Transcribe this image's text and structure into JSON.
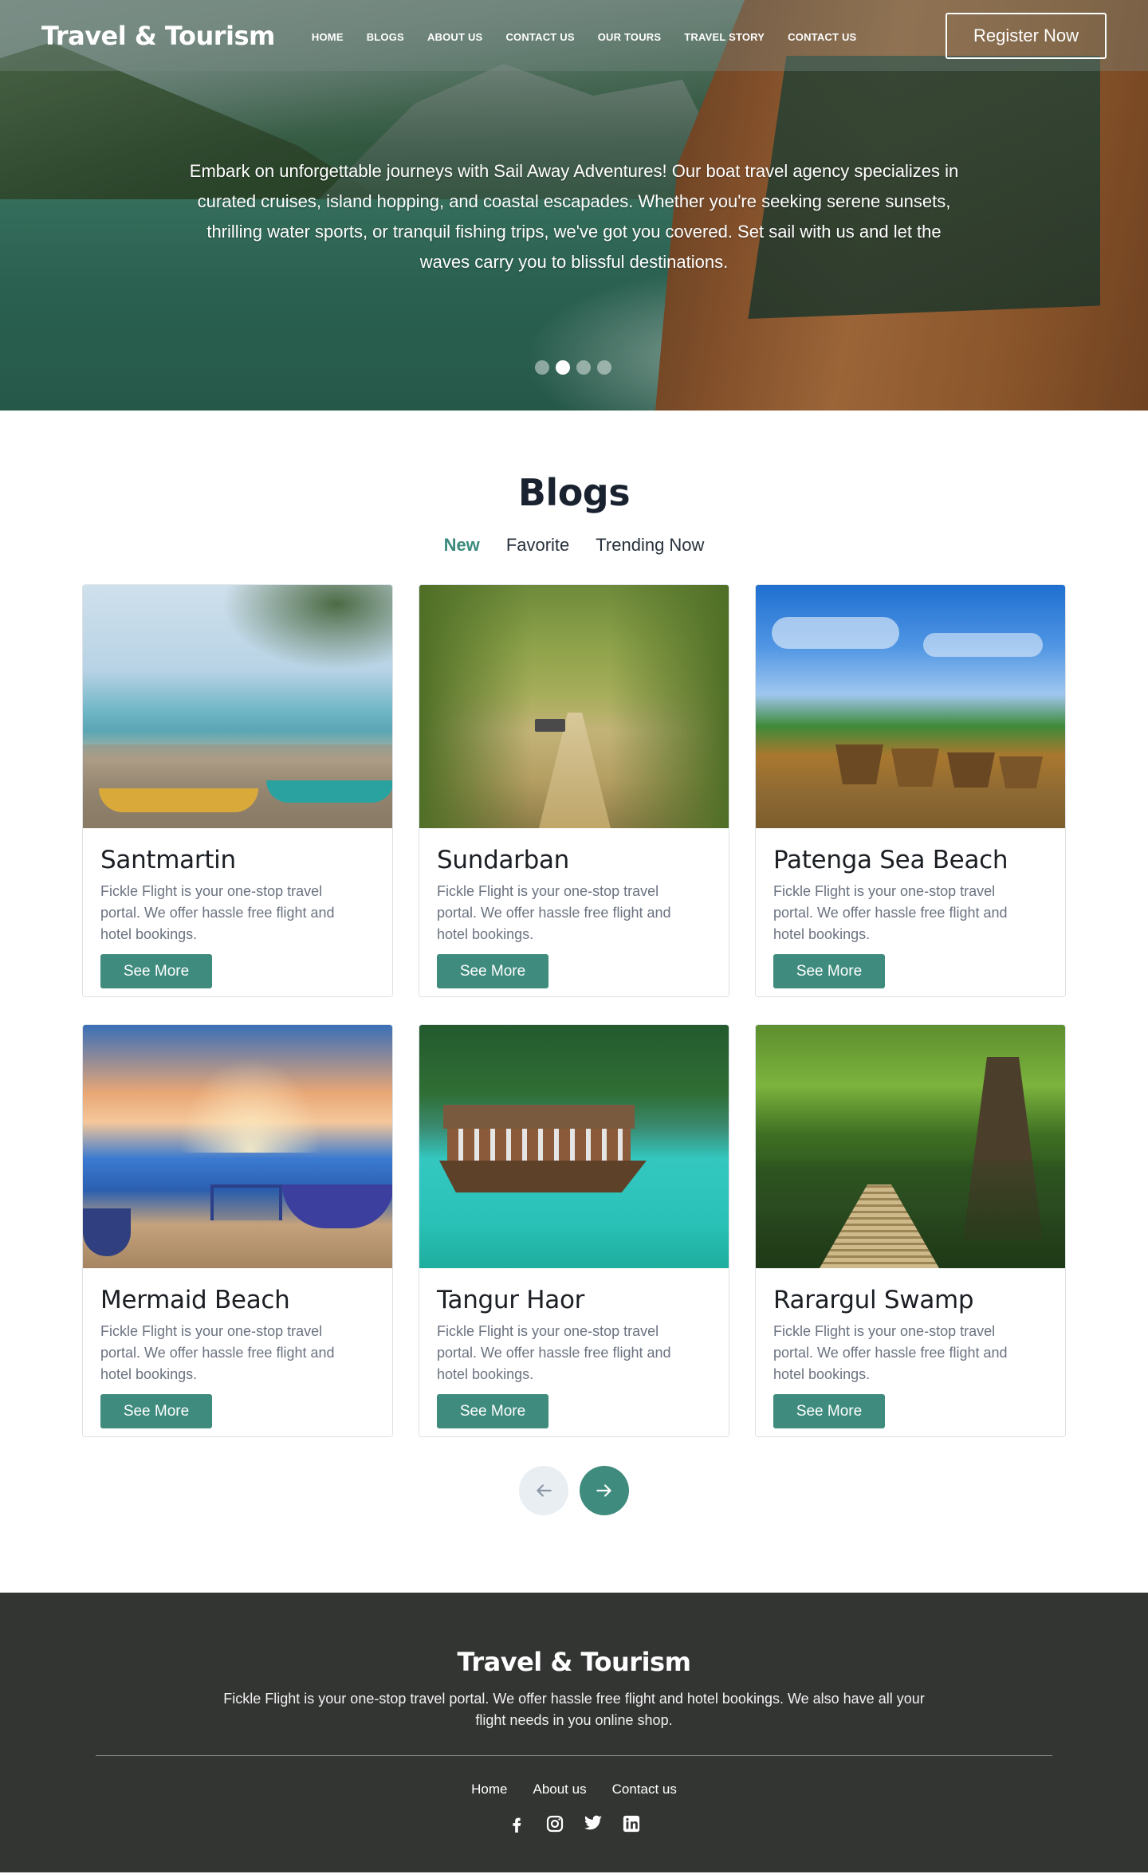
{
  "header": {
    "brand": "Travel & Tourism",
    "nav": [
      "HOME",
      "BLOGS",
      "ABOUT US",
      "CONTACT US",
      "OUR TOURS",
      "TRAVEL STORY",
      "CONTACT US"
    ],
    "register_label": "Register Now"
  },
  "hero": {
    "text": "Embark on unforgettable journeys with Sail Away Adventures! Our boat travel agency specializes in curated cruises, island hopping, and coastal escapades. Whether you're seeking serene sunsets, thrilling water sports, or tranquil fishing trips, we've got you covered. Set sail with us and let the waves carry you to blissful destinations.",
    "slides": 4,
    "active_slide": 2
  },
  "blogs": {
    "title": "Blogs",
    "tabs": [
      "New",
      "Favorite",
      "Trending Now"
    ],
    "active_tab": "New",
    "cards": [
      {
        "title": "Santmartin",
        "desc": "Fickle Flight is your one-stop travel portal. We offer hassle free flight and hotel bookings.",
        "button": "See More"
      },
      {
        "title": "Sundarban",
        "desc": "Fickle Flight is your one-stop travel portal. We offer hassle free flight and hotel bookings.",
        "button": "See More"
      },
      {
        "title": "Patenga Sea Beach",
        "desc": "Fickle Flight is your one-stop travel portal. We offer hassle free flight and hotel bookings.",
        "button": "See More"
      },
      {
        "title": "Mermaid Beach",
        "desc": "Fickle Flight is your one-stop travel portal. We offer hassle free flight and hotel bookings.",
        "button": "See More"
      },
      {
        "title": "Tangur Haor",
        "desc": "Fickle Flight is your one-stop travel portal. We offer hassle free flight and hotel bookings.",
        "button": "See More"
      },
      {
        "title": "Rarargul Swamp",
        "desc": "Fickle Flight is your one-stop travel portal. We offer hassle free flight and hotel bookings.",
        "button": "See More"
      }
    ],
    "pager": {
      "prev_icon": "arrow-left-icon",
      "next_icon": "arrow-right-icon"
    }
  },
  "footer": {
    "brand": "Travel & Tourism",
    "desc": "Fickle Flight is your one-stop travel portal. We offer hassle free flight and hotel bookings. We also have all your flight needs in you online shop.",
    "links": [
      "Home",
      "About  us",
      "Contact us"
    ],
    "socials": [
      "facebook-icon",
      "instagram-icon",
      "twitter-icon",
      "linkedin-icon"
    ]
  },
  "colors": {
    "accent": "#3f8b7e",
    "footer_bg": "#333533",
    "heading": "#1a2230"
  }
}
